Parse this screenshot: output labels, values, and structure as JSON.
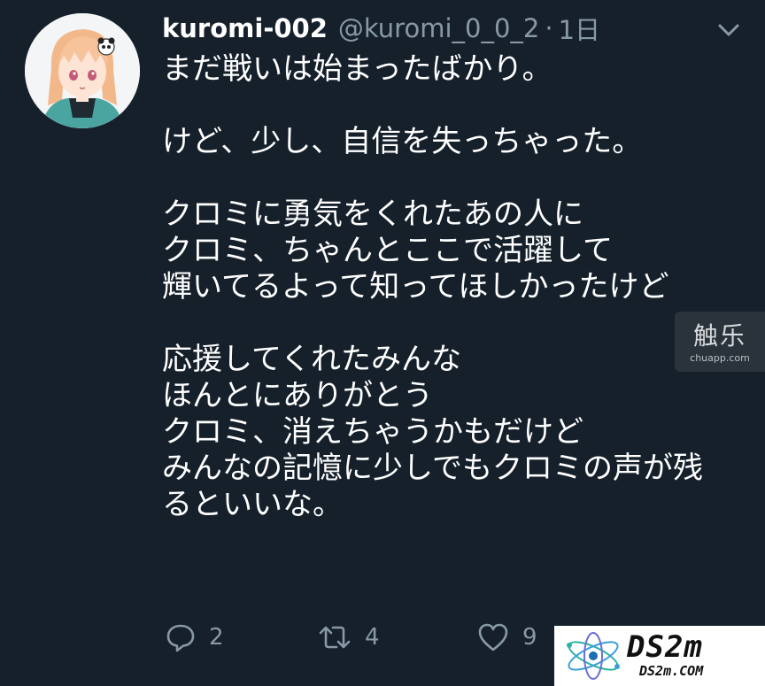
{
  "tweet": {
    "display_name": "kuromi-002",
    "handle": "@kuromi_0_0_2",
    "separator": "·",
    "time": "1日",
    "lines": [
      "まだ戦いは始まったばかり。",
      "",
      "けど、少し、自信を失っちゃった。",
      "",
      "クロミに勇気をくれたあの人に",
      "クロミ、ちゃんとここで活躍して",
      "輝いてるよって知ってほしかったけど",
      "",
      "応援してくれたみんな",
      "ほんとにありがとう",
      "クロミ、消えちゃうかもだけど",
      "みんなの記憶に少しでもクロミの声が残",
      "るといいな。"
    ]
  },
  "actions": {
    "reply_count": "2",
    "retweet_count": "4",
    "like_count": "9"
  },
  "icons": {
    "menu": "chevron-down-icon",
    "reply": "reply-icon",
    "retweet": "retweet-icon",
    "like": "heart-icon"
  },
  "watermarks": {
    "chuapp_big": "触乐",
    "chuapp_small": "chuapp.com",
    "ds2m_brand": "DS2m",
    "ds2m_url": "DS2m.COM"
  },
  "colors": {
    "background": "#15202b",
    "text": "#ffffff",
    "secondary": "#8899a6"
  }
}
